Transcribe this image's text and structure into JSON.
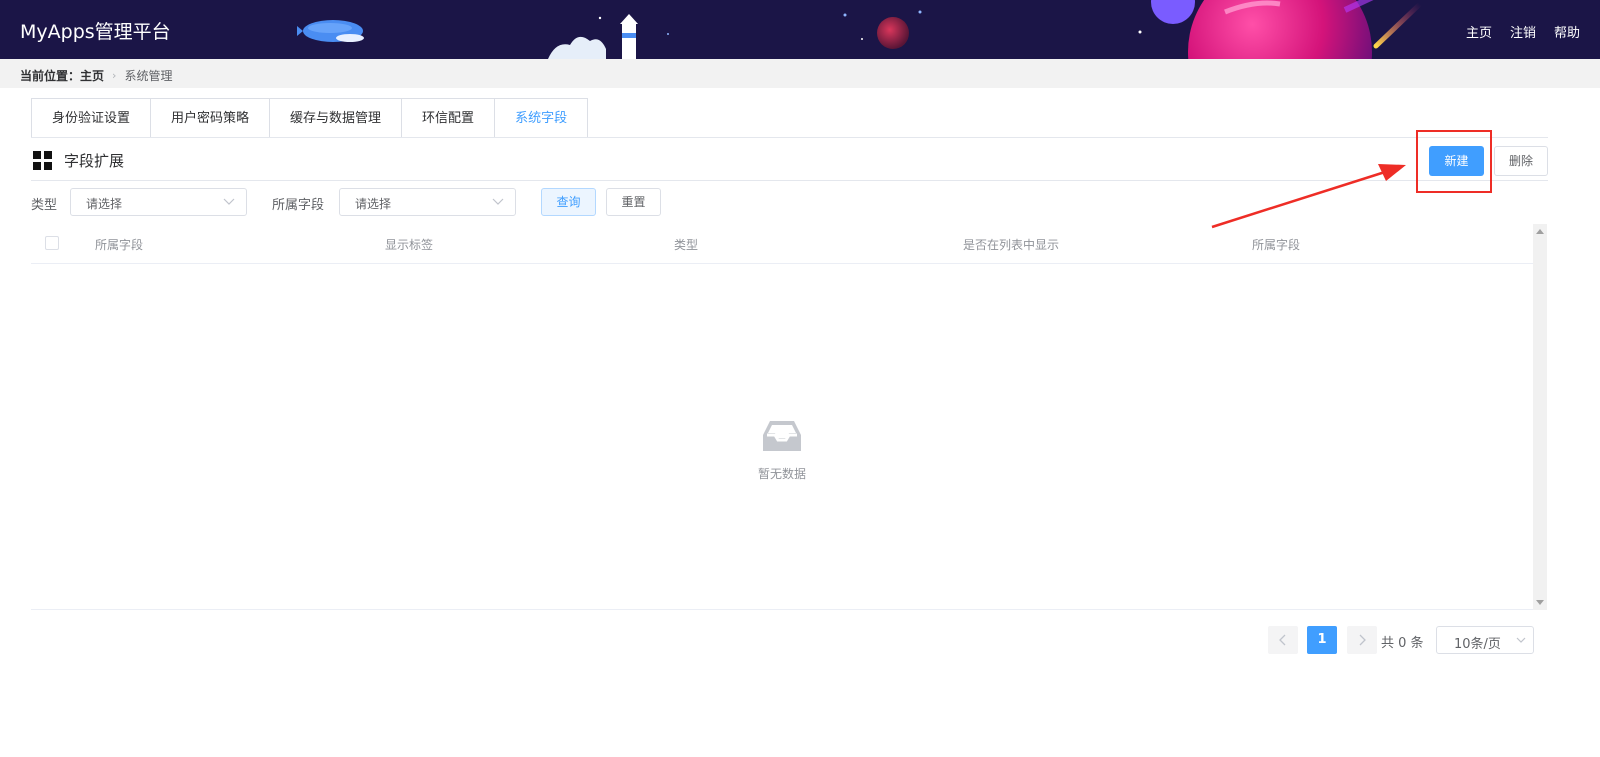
{
  "header": {
    "brand": "MyApps管理平台",
    "nav": [
      "主页",
      "注销",
      "帮助"
    ]
  },
  "breadcrumb": {
    "prefix": "当前位置：",
    "home": "主页",
    "current": "系统管理"
  },
  "tabs": [
    "身份验证设置",
    "用户密码策略",
    "缓存与数据管理",
    "环信配置",
    "系统字段"
  ],
  "active_tab": 4,
  "section": {
    "title": "字段扩展",
    "new_label": "新建",
    "delete_label": "删除"
  },
  "filters": {
    "type_label": "类型",
    "type_placeholder": "请选择",
    "field_label": "所属字段",
    "field_placeholder": "请选择",
    "query_label": "查询",
    "reset_label": "重置"
  },
  "table": {
    "columns": [
      "所属字段",
      "显示标签",
      "类型",
      "是否在列表中显示",
      "所属字段"
    ],
    "empty_text": "暂无数据"
  },
  "pagination": {
    "current_page": "1",
    "total_text": "共 0 条",
    "page_size": "10条/页"
  },
  "colors": {
    "accent": "#409eff",
    "header_bg": "#1b1547",
    "annotation_red": "#ee2d26"
  }
}
